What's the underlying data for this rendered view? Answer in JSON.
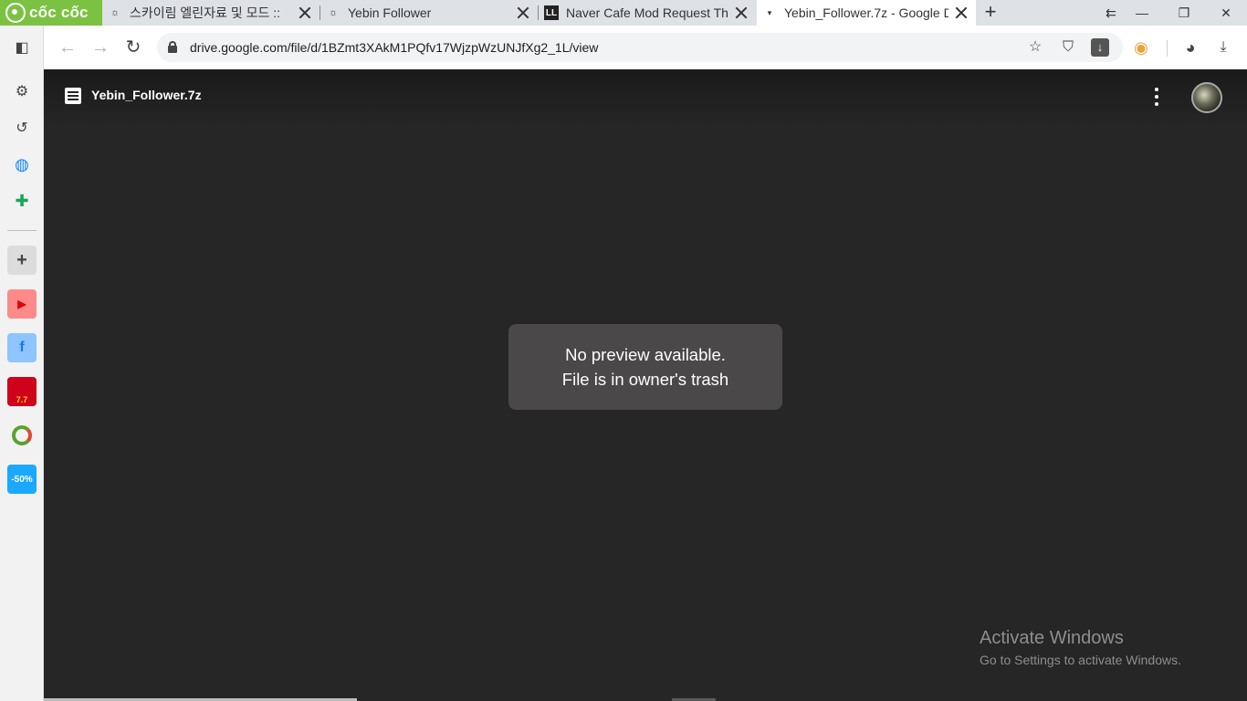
{
  "browser": {
    "brand": "cốc cốc",
    "tabs": [
      {
        "title": "스카이림 엘린자료 및 모드 ::",
        "favicon": "wizard-favicon",
        "active": false
      },
      {
        "title": "Yebin Follower",
        "favicon": "wizard-favicon",
        "active": false
      },
      {
        "title": "Naver Cafe Mod Request Thre",
        "favicon": "ll-favicon",
        "active": false
      },
      {
        "title": "Yebin_Follower.7z - Google D",
        "favicon": "drive-favicon",
        "active": true
      }
    ],
    "new_tab": "+",
    "url": "drive.google.com/file/d/1BZmt3XAkM1PQfv17WjzpWzUNJfXg2_1L/view"
  },
  "sidebar": {
    "items": [
      "reader-icon",
      "settings-icon",
      "history-icon",
      "messenger-icon",
      "gamepad-icon"
    ],
    "apps": [
      {
        "name": "add",
        "label": "+"
      },
      {
        "name": "youtube",
        "label": "▶"
      },
      {
        "name": "facebook",
        "label": "f"
      },
      {
        "name": "shopee",
        "label": "7.7"
      },
      {
        "name": "lemon",
        "label": ""
      },
      {
        "name": "tiki",
        "label": "-50%"
      }
    ]
  },
  "viewer": {
    "file_name": "Yebin_Follower.7z",
    "message_line1": "No preview available.",
    "message_line2": "File is in owner's trash"
  },
  "os": {
    "activate_title": "Activate Windows",
    "activate_sub": "Go to Settings to activate Windows."
  },
  "colors": {
    "brand_green": "#7cc242",
    "viewer_bg": "#262626",
    "preview_box": "#4a4849"
  }
}
